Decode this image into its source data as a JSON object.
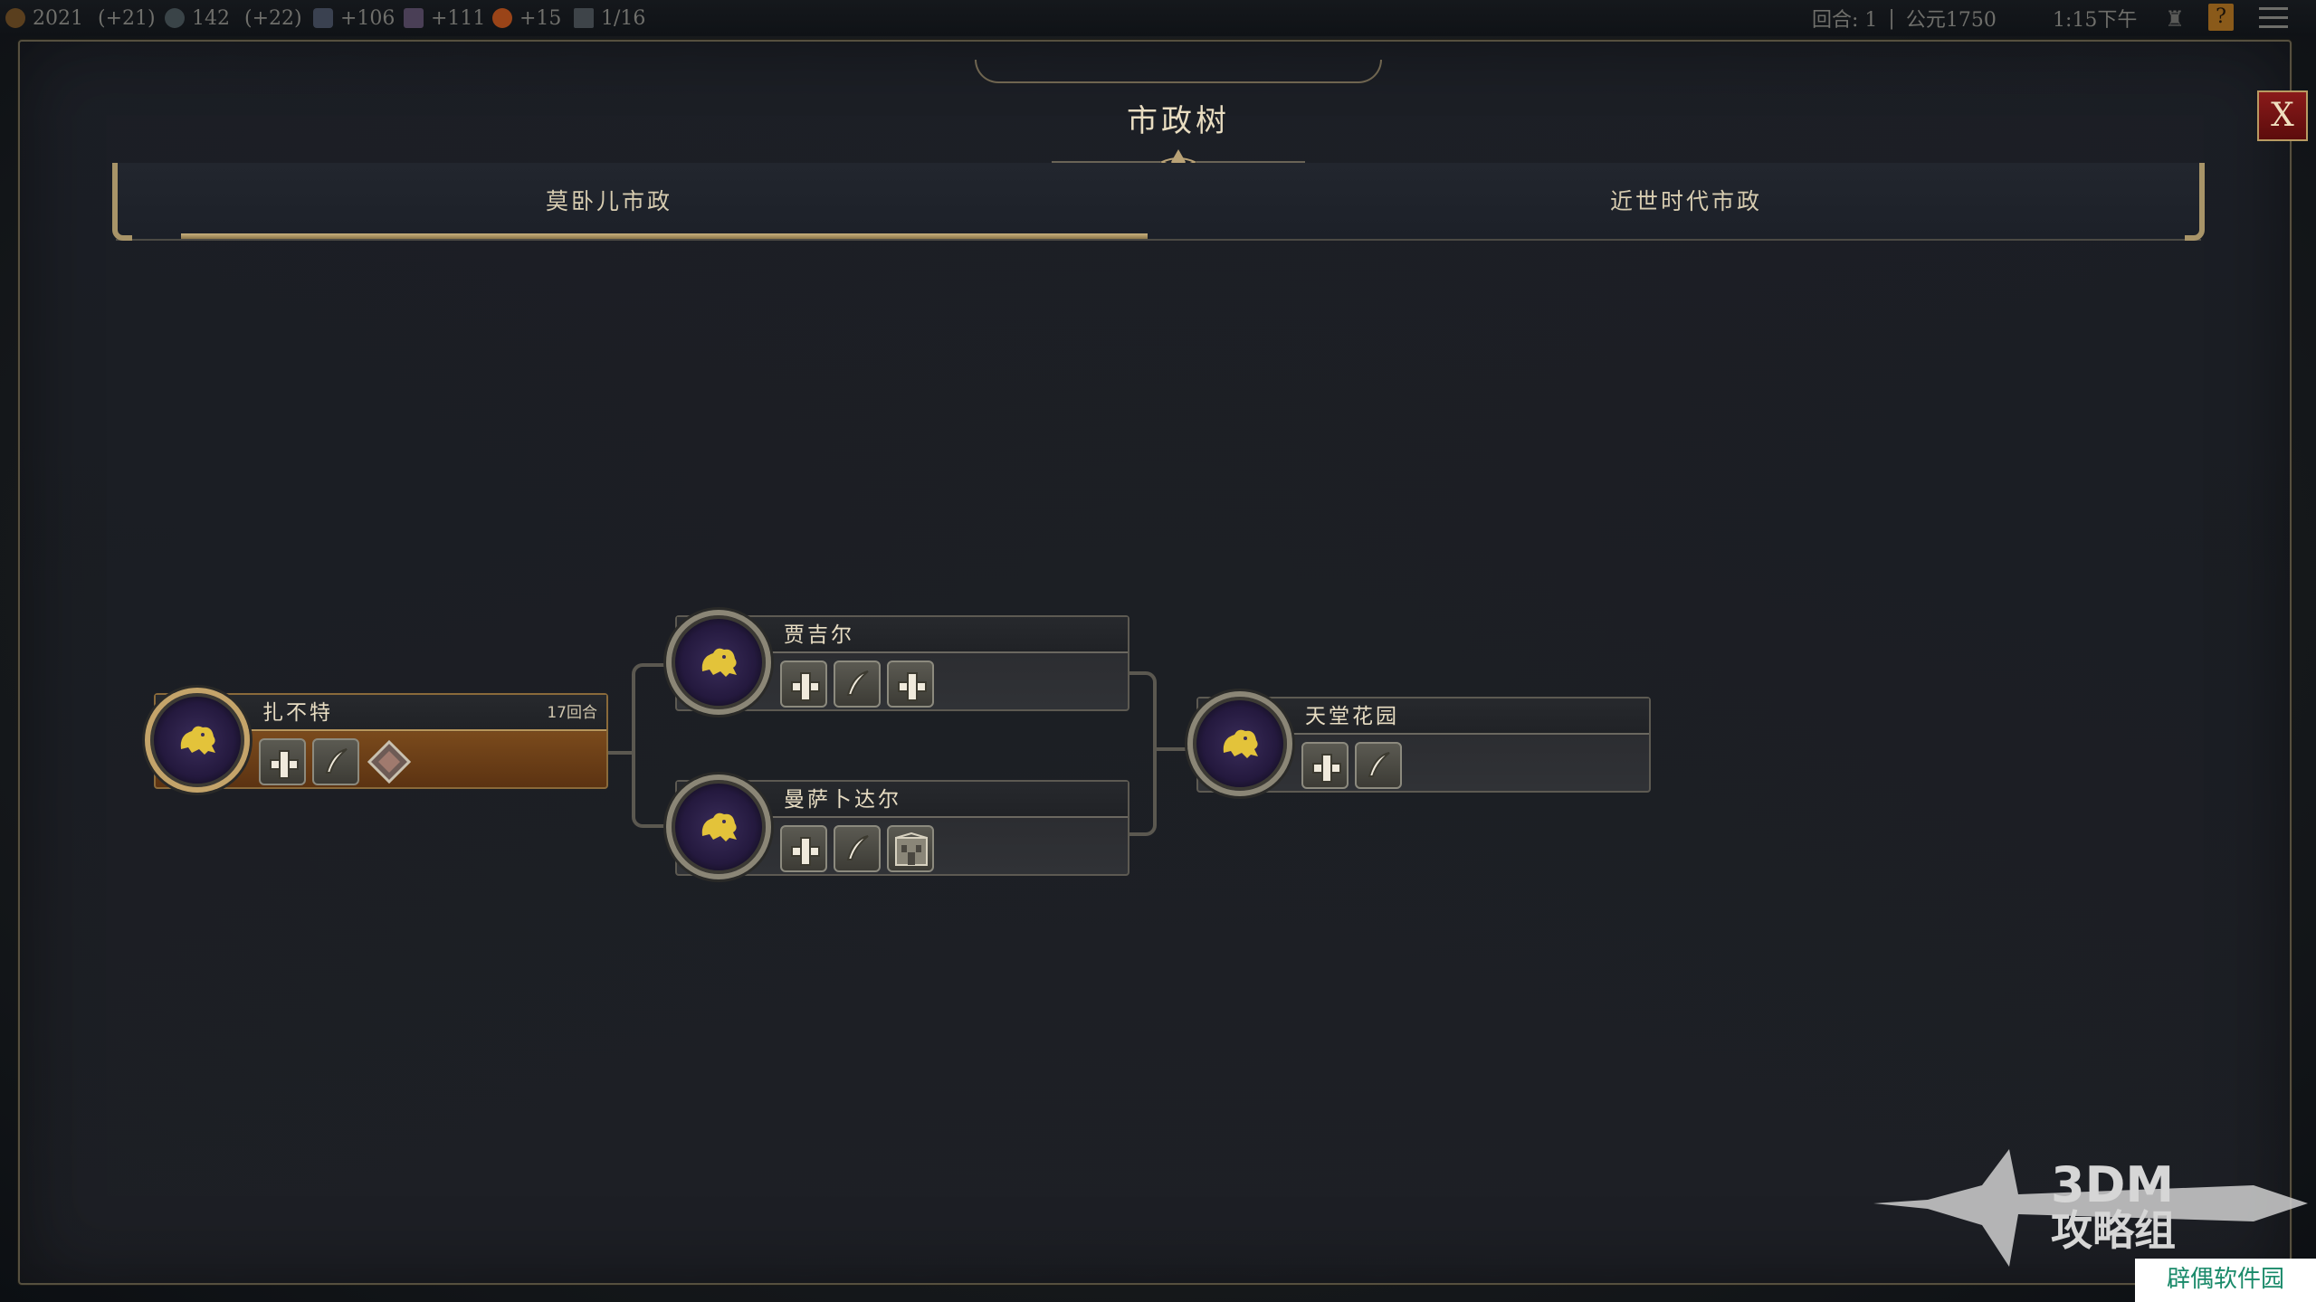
{
  "topbar": {
    "gold": "2021",
    "gold_rate": "(+21)",
    "science": "142",
    "science_rate": "(+22)",
    "faith": "+106",
    "culture": "+111",
    "tourism": "+15",
    "cities": "1/16",
    "turn": "回合: 1",
    "sep": "|",
    "year": "公元1750",
    "clock": "1:15下午",
    "help": "?"
  },
  "panel": {
    "title": "市政树",
    "close": "X"
  },
  "tabs": [
    {
      "label": "莫卧儿市政"
    },
    {
      "label": "近世时代市政"
    }
  ],
  "nodes": [
    {
      "name": "扎不特",
      "turns": "17回合"
    },
    {
      "name": "贾吉尔"
    },
    {
      "name": "曼萨卜达尔"
    },
    {
      "name": "天堂花园"
    }
  ],
  "watermark": {
    "line1": "3DM",
    "line2": "攻略组",
    "site": "辟偶软件园"
  },
  "colors": {
    "accent_gold": "#c4a46a",
    "close_red": "#8a1a1a",
    "current_node": "#7a4a1c"
  }
}
